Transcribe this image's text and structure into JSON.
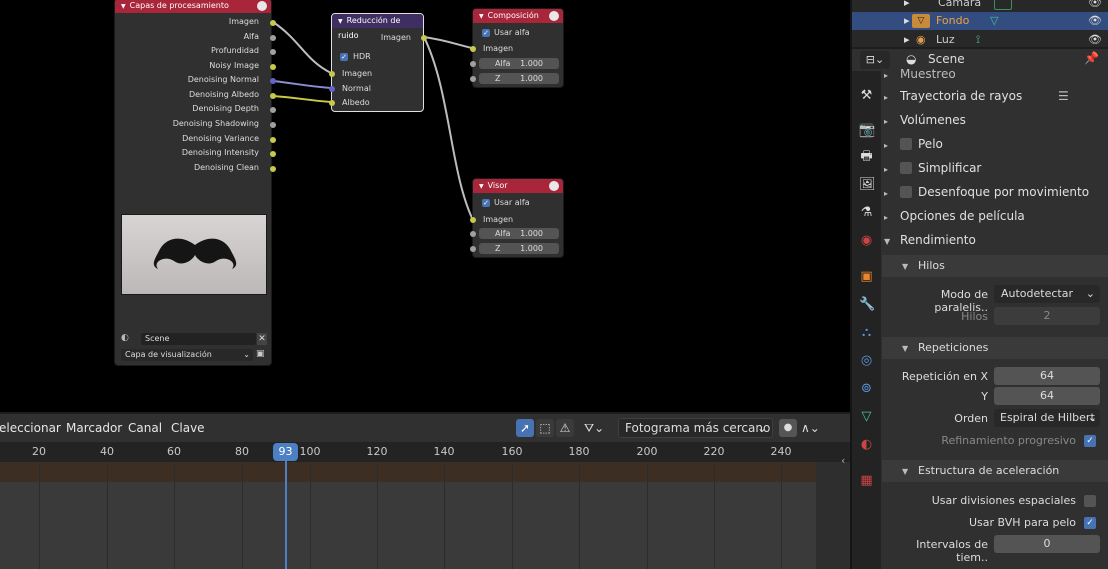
{
  "node_editor": {
    "render_layers": {
      "title": "Capas de procesamiento",
      "outputs": [
        "Imagen",
        "Alfa",
        "Profundidad",
        "Noisy Image",
        "Denoising Normal",
        "Denoising Albedo",
        "Denoising Depth",
        "Denoising Shadowing",
        "Denoising Variance",
        "Denoising Intensity",
        "Denoising Clean"
      ],
      "scene": "Scene",
      "layer": "Capa de visualización"
    },
    "denoise": {
      "title": "Reducción de ruido",
      "output": "Imagen",
      "hdr_label": "HDR",
      "inputs": [
        "Imagen",
        "Normal",
        "Albedo"
      ]
    },
    "composite": {
      "title": "Composición",
      "use_alpha": "Usar alfa",
      "input": "Imagen",
      "alpha_label": "Alfa",
      "alpha_value": "1.000",
      "z_label": "Z",
      "z_value": "1.000"
    },
    "viewer": {
      "title": "Visor",
      "use_alpha": "Usar alfa",
      "input": "Imagen",
      "alpha_label": "Alfa",
      "alpha_value": "1.000",
      "z_label": "Z",
      "z_value": "1.000"
    }
  },
  "timeline": {
    "menus": [
      "eleccionar",
      "Marcador",
      "Canal",
      "Clave"
    ],
    "snap": "Fotograma más cercano",
    "current_frame": "93",
    "ticks": [
      "20",
      "40",
      "60",
      "80",
      "100",
      "120",
      "140",
      "160",
      "180",
      "200",
      "220",
      "240"
    ]
  },
  "outliner": {
    "items": [
      "Cámara",
      "Fondo",
      "Luz"
    ]
  },
  "properties": {
    "scene_name": "Scene",
    "sections": {
      "muestreo": "Muestreo",
      "trayectoria": "Trayectoria de rayos",
      "volumenes": "Volúmenes",
      "pelo": "Pelo",
      "simplificar": "Simplificar",
      "desenfoque": "Desenfoque por movimiento",
      "pelicula": "Opciones de película",
      "rendimiento": "Rendimiento"
    },
    "hilos": {
      "title": "Hilos",
      "mode_label": "Modo de paralelis..",
      "mode_value": "Autodetectar",
      "threads_label": "Hilos",
      "threads_value": "2"
    },
    "repeticiones": {
      "title": "Repeticiones",
      "x_label": "Repetición en  X",
      "x_value": "64",
      "y_label": "Y",
      "y_value": "64",
      "order_label": "Orden",
      "order_value": "Espiral de Hilbert",
      "progressive_label": "Refinamiento progresivo"
    },
    "aceleracion": {
      "title": "Estructura de aceleración",
      "spatial_label": "Usar divisiones espaciales",
      "hair_bvh_label": "Usar BVH para pelo",
      "intervals_label": "Intervalos de tiem..",
      "intervals_value": "0"
    }
  },
  "colors": {
    "accent": "#4772b3",
    "node_red": "#a8253a",
    "node_purple": "#3f2e62",
    "socket_yellow": "#c8c84a",
    "socket_purple": "#6464c8",
    "playhead": "#4c7fc4",
    "selected_row": "#334d80"
  }
}
